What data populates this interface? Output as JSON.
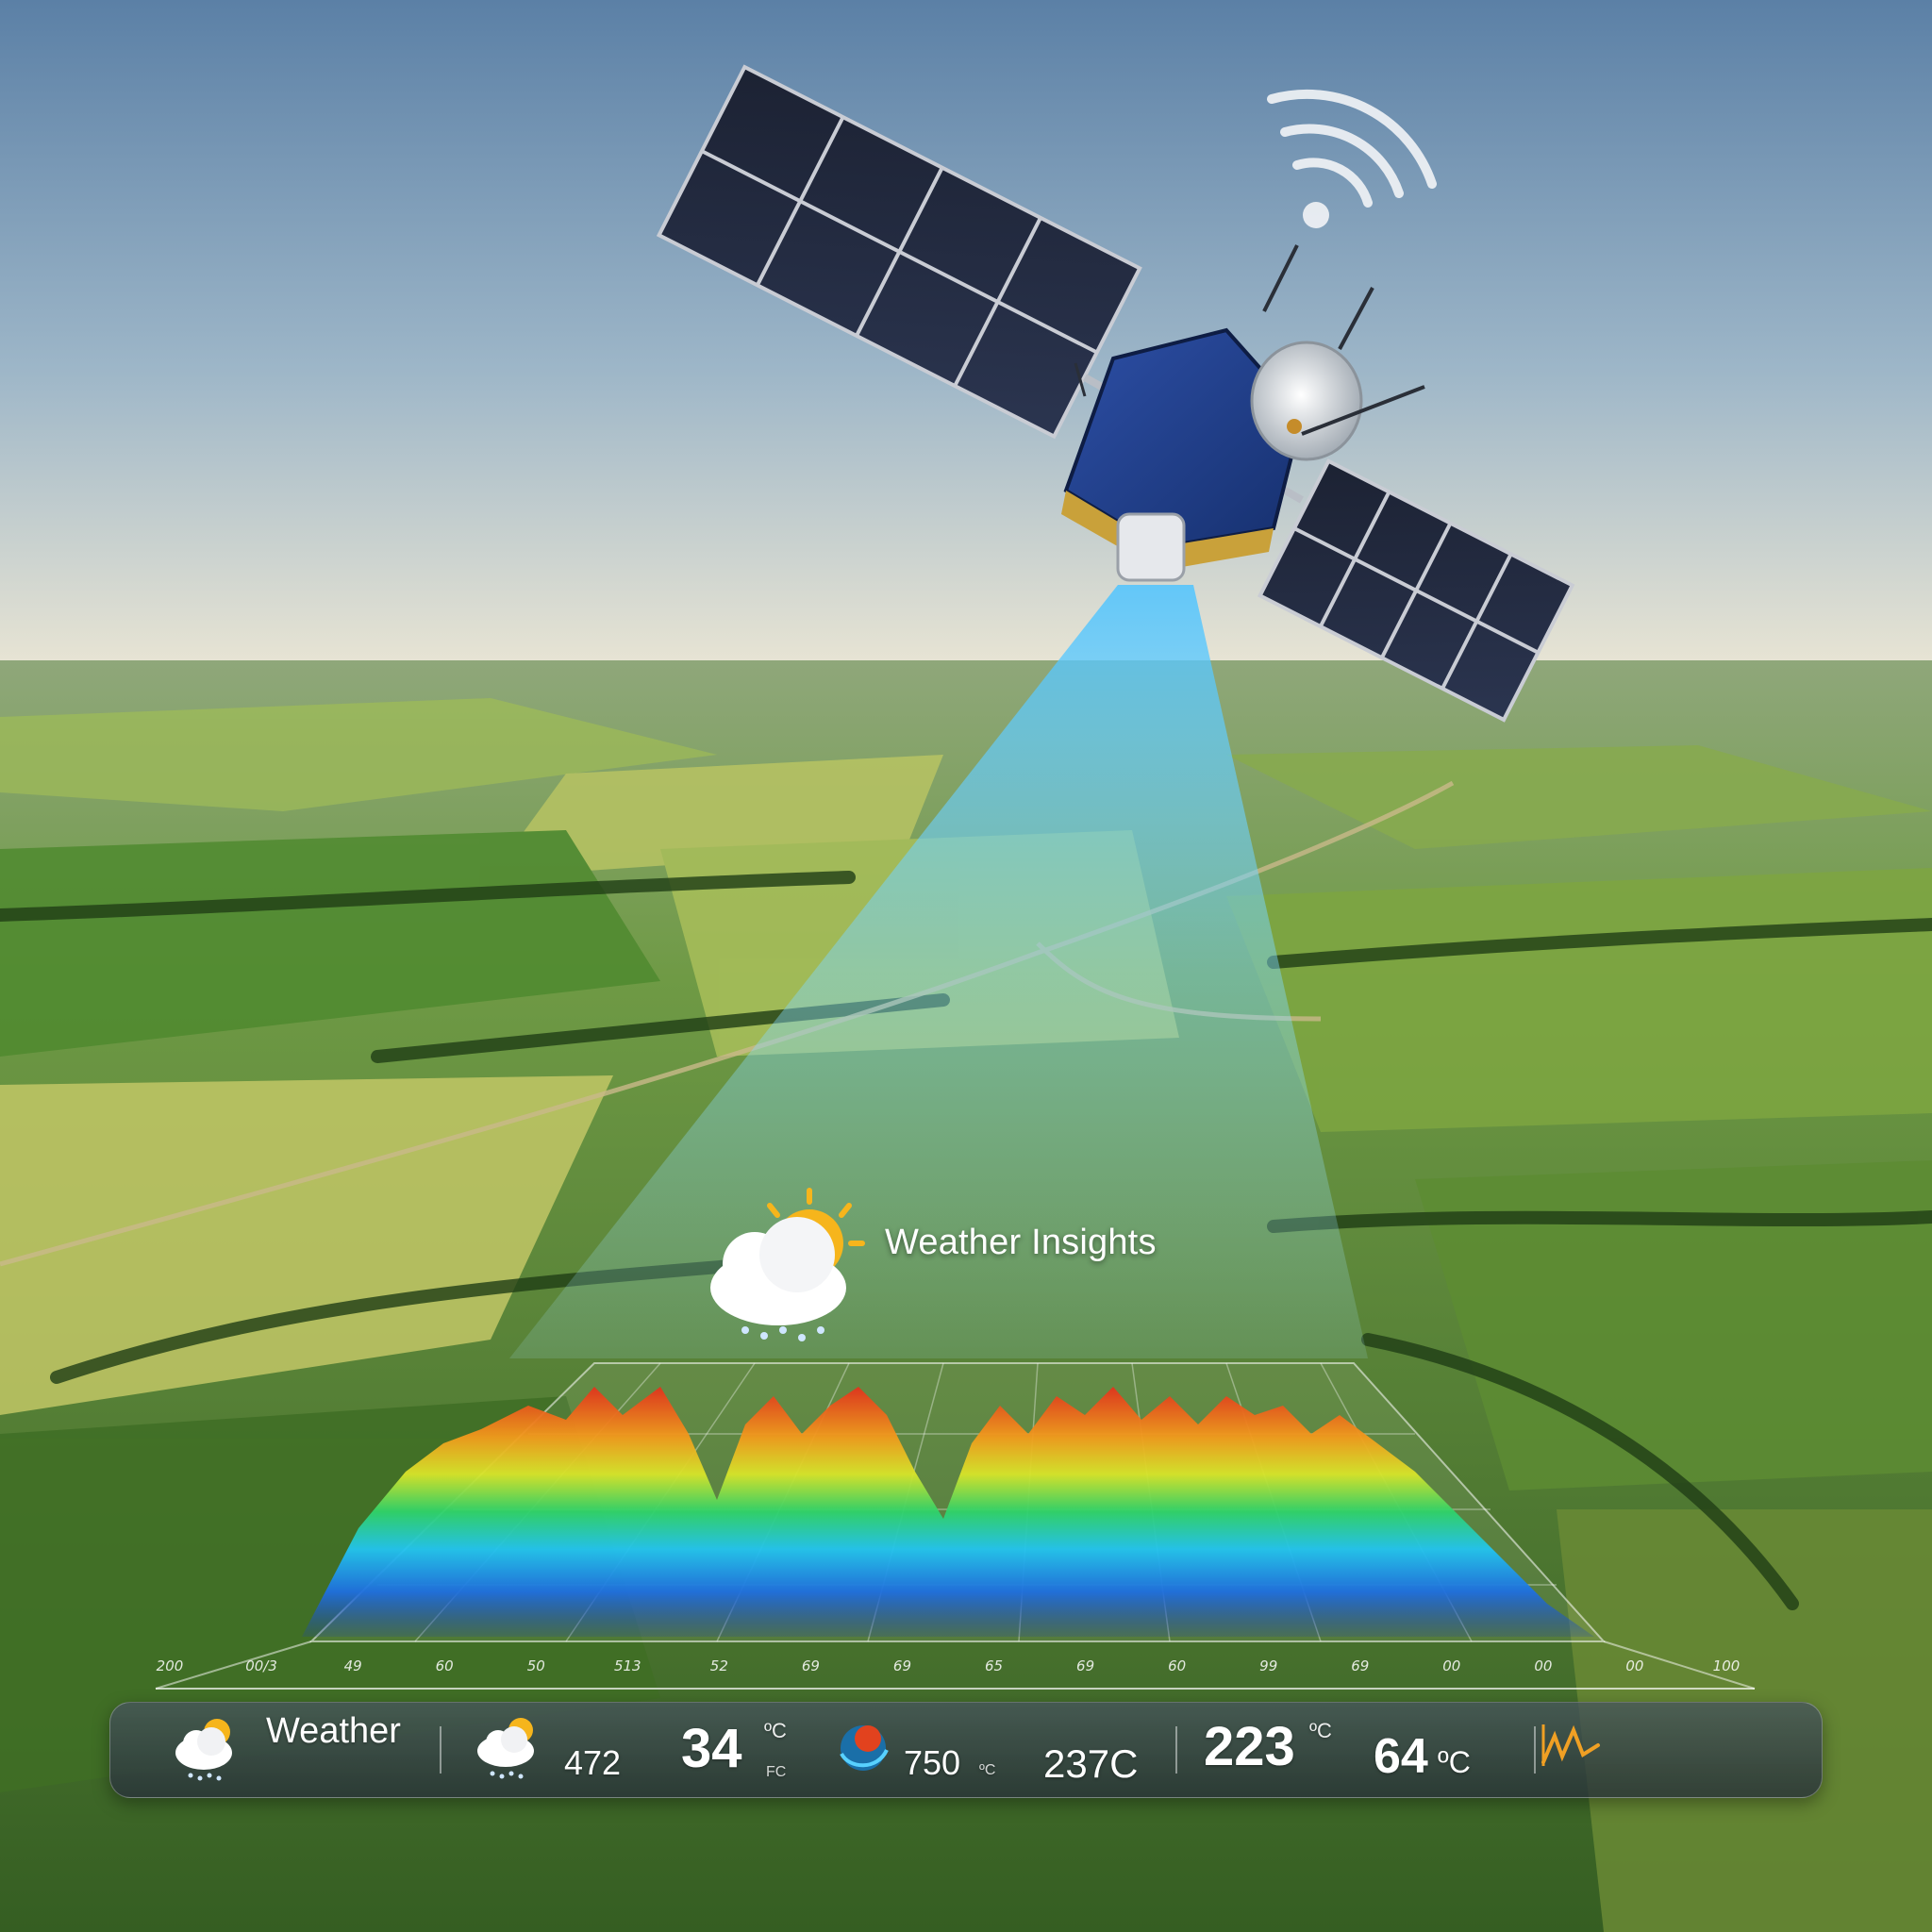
{
  "overlay": {
    "title": "Weather Insights"
  },
  "chart_axis": {
    "ticks": [
      "200",
      "00/3",
      "49",
      "60",
      "50",
      "513",
      "52",
      "69",
      "69",
      "65",
      "69",
      "60",
      "99",
      "69",
      "00",
      "00",
      "00",
      "100"
    ]
  },
  "weather_bar": {
    "label": "Weather",
    "reading_1": "472",
    "reading_2": "34",
    "reading_2_unit": "ºC",
    "reading_2_sub": "FC",
    "reading_3": "750",
    "reading_3_unit": "ºC",
    "reading_4": "237C",
    "reading_5": "223",
    "reading_5_unit": "ºC",
    "reading_6": "64",
    "reading_6_unit": "ºC"
  },
  "colors": {
    "sky_top": "#5d83a8",
    "sky_horizon": "#e7e3d2",
    "field_green": "#5f8a3a",
    "beam_blue": "#7ad6ff",
    "heat_red": "#e0301e",
    "heat_blue": "#1e5fd8"
  },
  "icons": [
    "satellite-icon",
    "wifi-signal-icon",
    "sun-cloud-rain-icon",
    "globe-icon",
    "trend-chart-icon"
  ]
}
